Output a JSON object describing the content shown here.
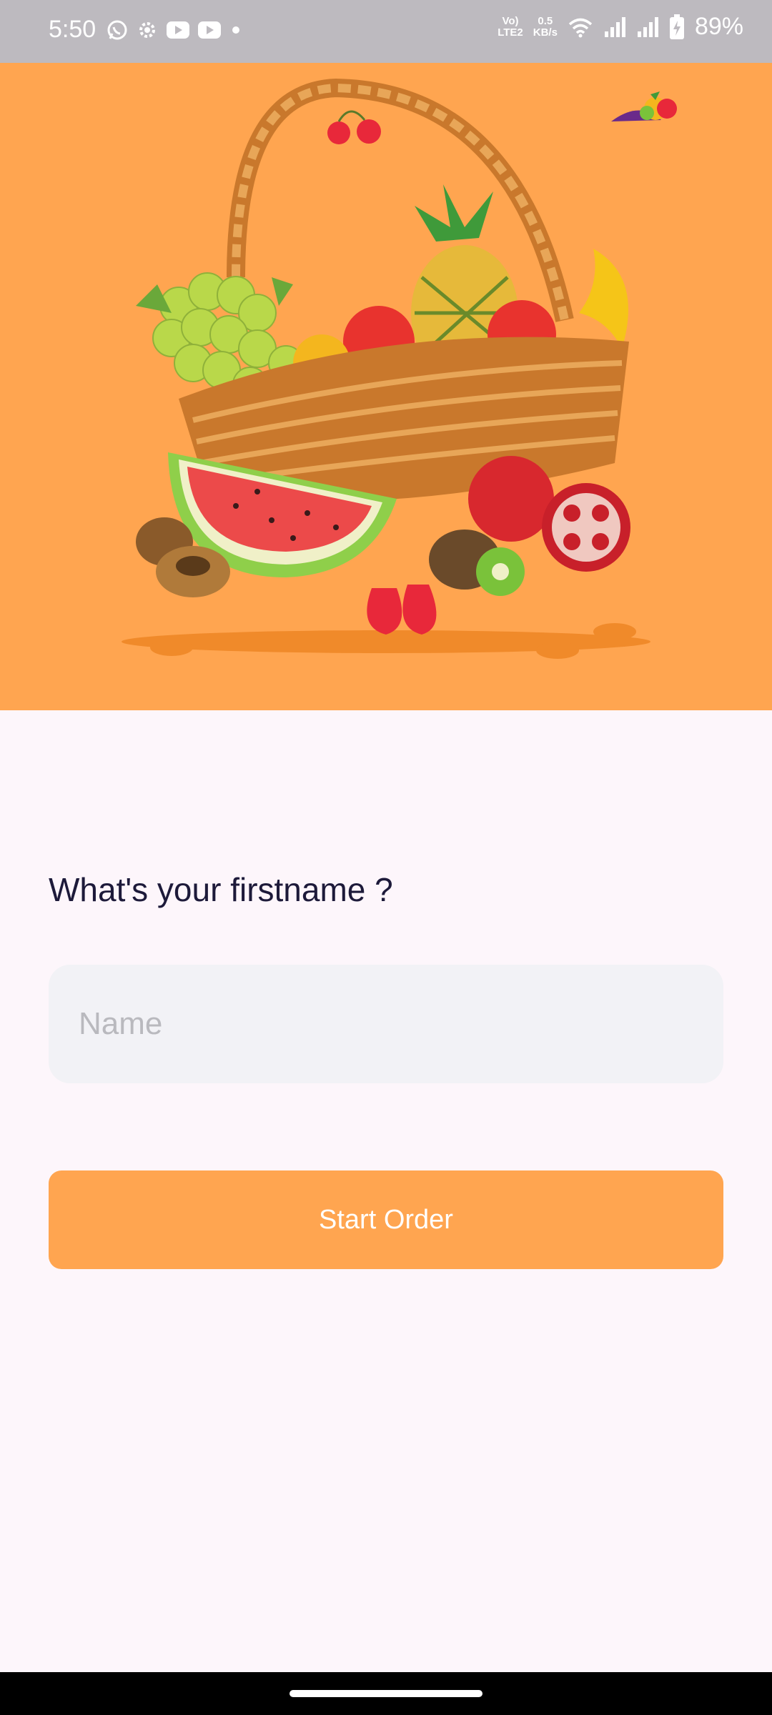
{
  "status_bar": {
    "time": "5:50",
    "network_type": "LTE2",
    "network_label": "Vo)",
    "speed_value": "0.5",
    "speed_unit": "KB/s",
    "battery": "89%",
    "icons": [
      "whatsapp-icon",
      "settings-icon",
      "youtube-icon",
      "youtube-icon",
      "dot-icon",
      "wifi-icon",
      "signal-icon",
      "signal-icon",
      "battery-charging-icon"
    ]
  },
  "hero": {
    "background_color": "#ffa550",
    "image": "fruit-basket-illustration",
    "logo": "fruit-logo-icon"
  },
  "form": {
    "question": "What's your firstname ?",
    "name_placeholder": "Name",
    "name_value": "",
    "start_button_label": "Start Order"
  },
  "colors": {
    "accent": "#ffa550",
    "page_background": "#fdf6fb",
    "input_background": "#f2f2f6",
    "heading_text": "#1d1a3a"
  }
}
